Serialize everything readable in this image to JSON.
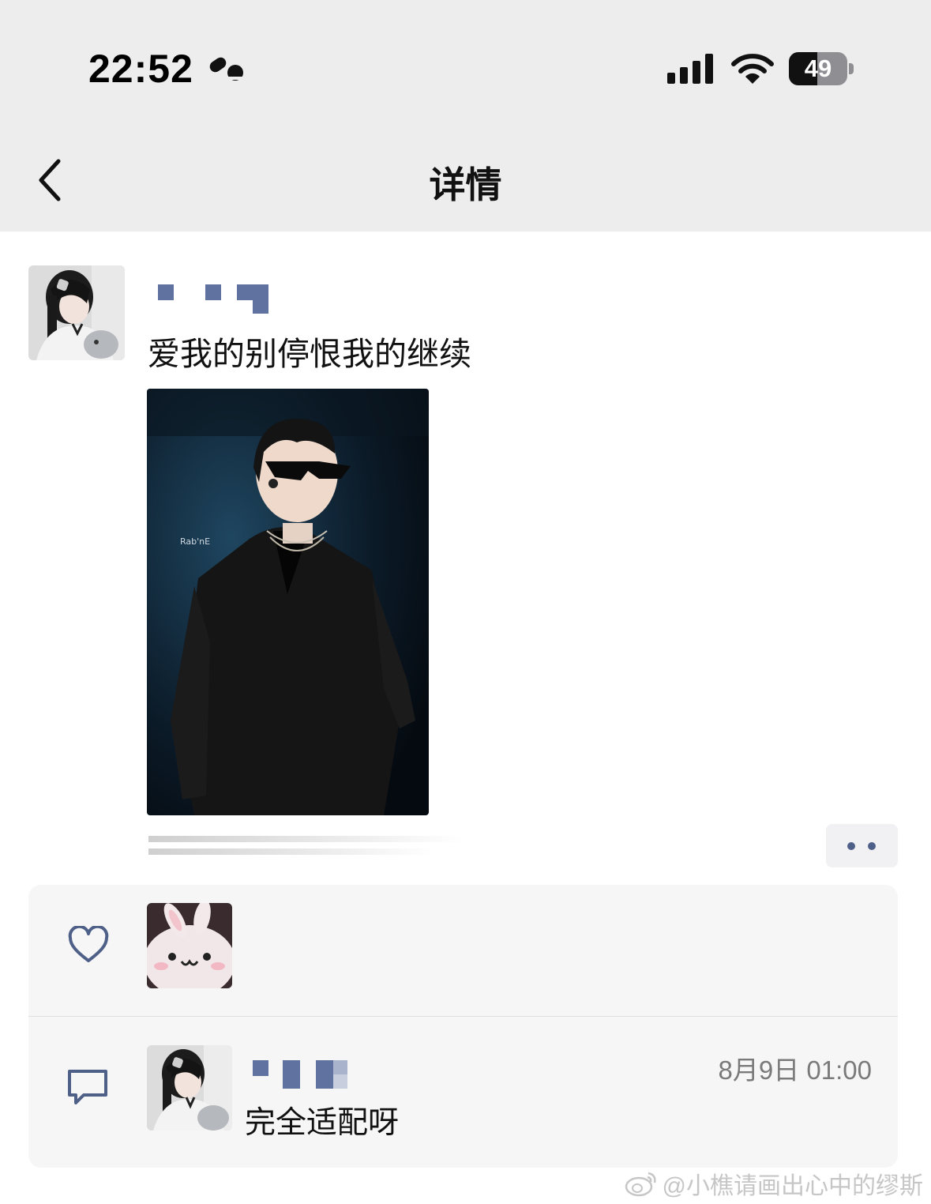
{
  "status_bar": {
    "time": "22:52",
    "battery_level": "49",
    "battery_fraction": 0.49
  },
  "nav": {
    "back_icon": "chevron-left-icon",
    "title": "详情"
  },
  "post": {
    "text": "爱我的别停恨我的继续",
    "more_icon": "two-dots-icon"
  },
  "likes": {
    "icon": "heart-outline-icon"
  },
  "comments": [
    {
      "time": "8月9日 01:00",
      "text": "完全适配呀"
    }
  ],
  "comment_icon": "speech-bubble-icon",
  "watermark": {
    "text": "@小樵请画出心中的缪斯"
  },
  "colors": {
    "accent": "#4f6088",
    "header_bg": "#ededed",
    "panel_bg": "#f6f6f7"
  }
}
